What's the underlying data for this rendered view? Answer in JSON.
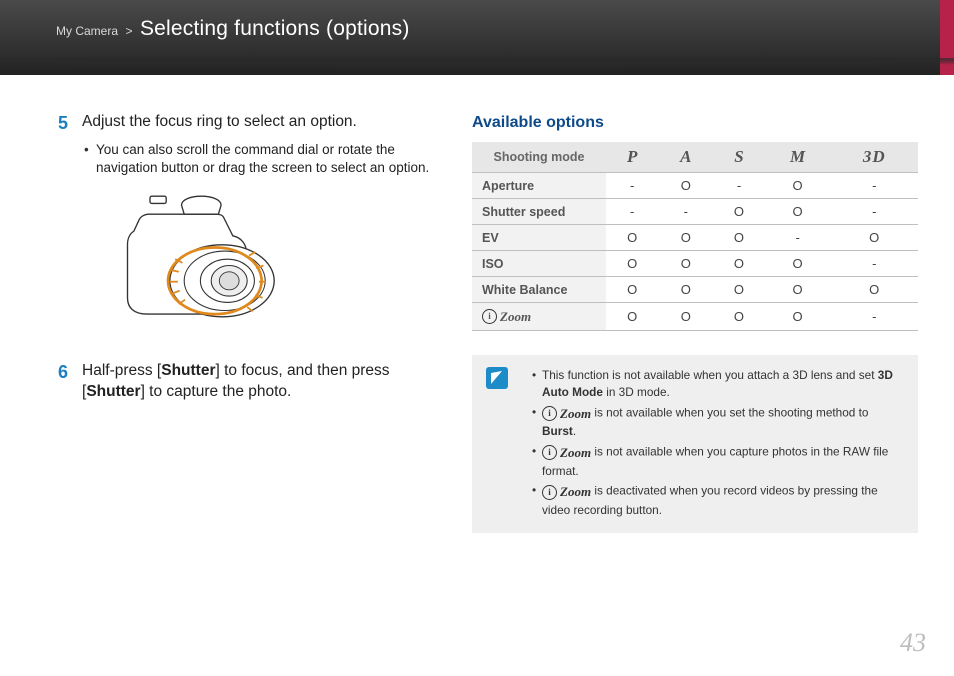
{
  "header": {
    "crumb": "My Camera",
    "sep": ">",
    "title": "Selecting functions (options)"
  },
  "steps": {
    "s5": {
      "num": "5",
      "text": "Adjust the focus ring to select an option."
    },
    "s5_bullet": "You can also scroll the command dial or rotate the navigation button or drag the screen to select an option.",
    "s6": {
      "num": "6",
      "pre": "Half-press [",
      "b1": "Shutter",
      "mid": "] to focus, and then press [",
      "b2": "Shutter",
      "post": "] to capture the photo."
    }
  },
  "table": {
    "heading": "Available options",
    "head": [
      "Shooting mode",
      "P",
      "A",
      "S",
      "M",
      "3D"
    ],
    "rows": [
      {
        "label": "Aperture",
        "c": [
          "-",
          "O",
          "-",
          "O",
          "-"
        ]
      },
      {
        "label": "Shutter speed",
        "c": [
          "-",
          "-",
          "O",
          "O",
          "-"
        ]
      },
      {
        "label": "EV",
        "c": [
          "O",
          "O",
          "O",
          "-",
          "O"
        ]
      },
      {
        "label": "ISO",
        "c": [
          "O",
          "O",
          "O",
          "O",
          "-"
        ]
      },
      {
        "label": "White Balance",
        "c": [
          "O",
          "O",
          "O",
          "O",
          "O"
        ]
      },
      {
        "label": "iZoom",
        "c": [
          "O",
          "O",
          "O",
          "O",
          "-"
        ],
        "izoom": true
      }
    ]
  },
  "note": {
    "n1a": "This function is not available when you attach a 3D lens and set ",
    "n1b": "3D Auto Mode",
    "n1c": " in 3D mode.",
    "n2a": " is not available when you set the shooting method to ",
    "n2b": "Burst",
    "n2c": ".",
    "n3": " is not available when you capture photos in the RAW file format.",
    "n4": " is deactivated when you record videos by pressing the video recording button."
  },
  "izoom_word": "Zoom",
  "page_number": "43"
}
